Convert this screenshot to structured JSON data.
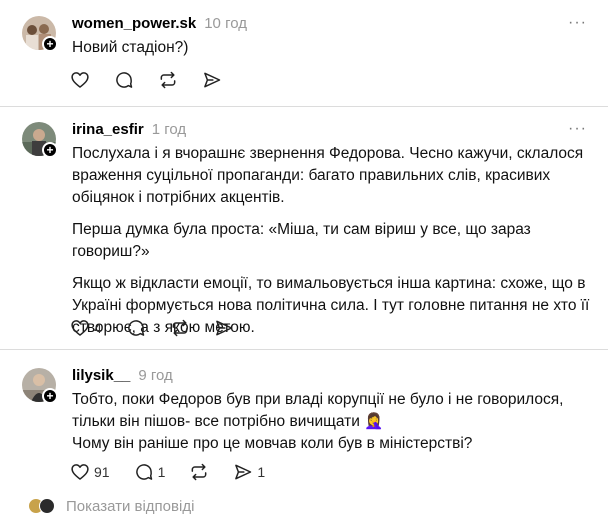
{
  "posts": [
    {
      "username": "women_power.sk",
      "time": "10 год",
      "paragraphs": [
        "Новий стадіон?)"
      ],
      "likes": "",
      "comments": "",
      "reposts": "",
      "shares": ""
    },
    {
      "username": "irina_esfir",
      "time": "1 год",
      "paragraphs": [
        "Послухала і я вчорашнє звернення Федорова. Чесно кажучи, склалося враження суцільної пропаганди: багато правильних слів, красивих обіцянок і потрібних акцентів.",
        "Перша думка була проста: «Міша, ти сам віриш у все, що зараз говориш?»",
        "Якщо ж відкласти емоції, то вимальовується інша картина: схоже, що в Україні формується нова політична сила. І тут головне питання не хто її створює, а з якою метою."
      ],
      "likes": "4",
      "comments": "",
      "reposts": "",
      "shares": ""
    },
    {
      "username": "lilysik__",
      "time": "9 год",
      "paragraphs": [
        "Тобто, поки Федоров був при владі корупції не було і не говорилося, тільки він пішов- все потрібно вичищати 🤦‍♀️",
        "Чому він раніше про це мовчав коли був в міністерстві?"
      ],
      "likes": "91",
      "comments": "1",
      "reposts": "",
      "shares": "1"
    }
  ],
  "show_replies_label": "Показати відповіді",
  "colors": {
    "divider": "#dcdcdc",
    "muted": "#999999",
    "text": "#111111"
  },
  "icons": [
    "heart-icon",
    "comment-icon",
    "repost-icon",
    "share-icon",
    "more-icon",
    "follow-plus-icon"
  ]
}
